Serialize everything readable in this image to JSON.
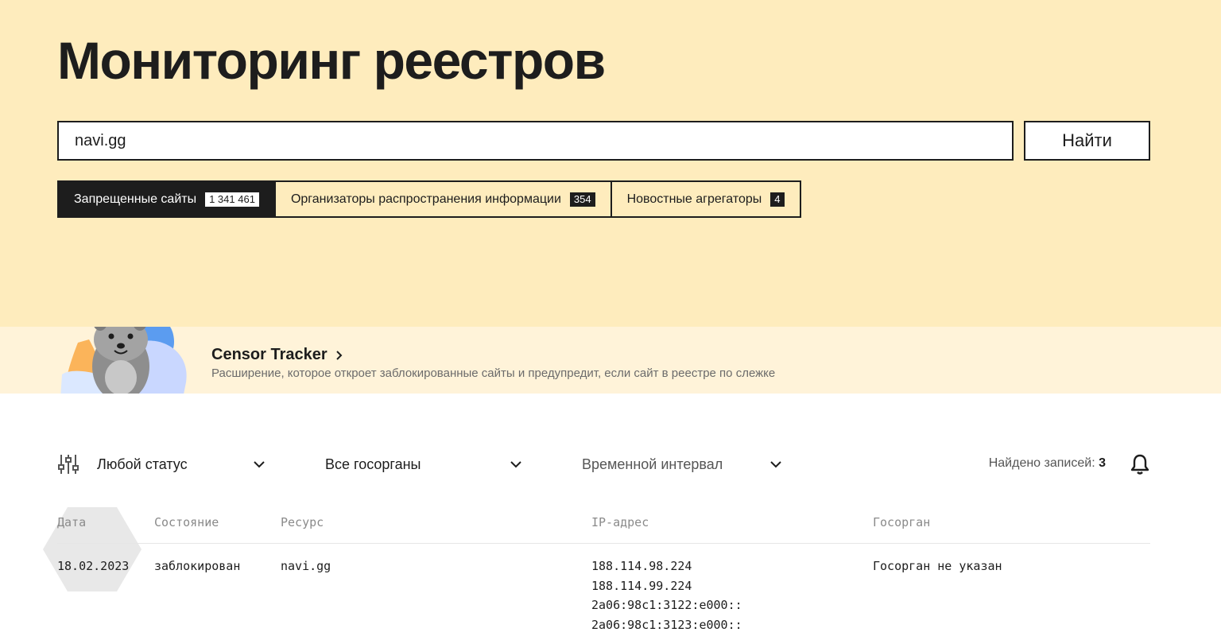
{
  "header": {
    "title": "Мониторинг реестров",
    "search_value": "navi.gg",
    "search_button": "Найти"
  },
  "tabs": [
    {
      "label": "Запрещенные сайты",
      "count": "1 341 461",
      "active": true
    },
    {
      "label": "Организаторы распространения информации",
      "count": "354",
      "active": false
    },
    {
      "label": "Новостные агрегаторы",
      "count": "4",
      "active": false
    }
  ],
  "promo": {
    "title": "Censor Tracker",
    "description": "Расширение, которое откроет заблокированные сайты и предупредит, если сайт в реестре по слежке"
  },
  "filters": {
    "status": "Любой статус",
    "authority": "Все госорганы",
    "interval": "Временной интервал",
    "found_label": "Найдено записей:",
    "found_count": "3"
  },
  "table": {
    "headers": [
      "Дата",
      "Состояние",
      "Ресурс",
      "IP-адрес",
      "Госорган"
    ],
    "rows": [
      {
        "date": "18.02.2023",
        "state": "заблокирован",
        "resource": "navi.gg",
        "ips": [
          "188.114.98.224",
          "188.114.99.224",
          "2a06:98c1:3122:e000::",
          "2a06:98c1:3123:e000::"
        ],
        "authority": "Госорган не указан"
      }
    ]
  },
  "colors": {
    "hero_bg": "#feecbd",
    "promo_bg": "#fff3d9",
    "ink": "#1d1d1d"
  }
}
